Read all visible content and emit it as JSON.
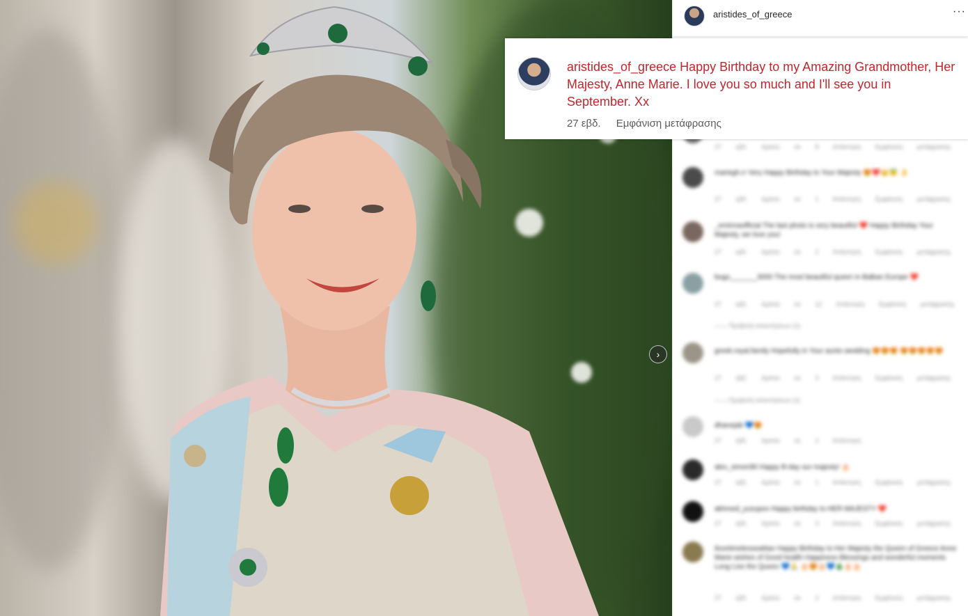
{
  "post": {
    "username": "aristides_of_greece",
    "caption_text": "Happy Birthday to my Amazing Grandmother, Her Majesty, Anne Marie. I love you so much and I'll see you in September. Xx",
    "time_ago": "27 εβδ.",
    "translation_link": "Εμφάνιση μετάφρασης"
  },
  "comments": [
    {
      "avatar_color": "#6b6b6b",
      "text": "",
      "meta": "27 εβδ. Αρέσει σε 8 Απάντηση Εμφάνιση μετάφρασης"
    },
    {
      "avatar_color": "#4b4b4b",
      "text": "mariegh.rr Very Happy Birthday to Your Majesty 😍❤️👑😇 👌",
      "meta": "27 εβδ. Αρέσει σε 1 Απάντηση Εμφάνιση μετάφρασης"
    },
    {
      "avatar_color": "#7a6760",
      "text": "_eminnaofficial The last photo is very beautiful ❤️ Happy Birthday Your Majesty, we love you!",
      "meta": "27 εβδ. Αρέσει σε 2 Απάντηση Εμφάνιση μετάφρασης"
    },
    {
      "avatar_color": "#8aa0a4",
      "text": "bogo_______3000 The most beautiful queen in Balkan Europe ❤️",
      "meta": "27 εβδ. Αρέσει σε 12 Απάντηση Εμφάνιση μετάφρασης",
      "replies": "—— Προβολή απαντήσεων (1)"
    },
    {
      "avatar_color": "#9c9488",
      "text": "greek.royal.family Hopefully in Your aunts wedding 😍😍😍 😍😍😍😍😍",
      "meta": "27 εβδ. Αρέσει σε 3 Απάντηση Εμφάνιση μετάφρασης",
      "replies": "—— Προβολή απαντήσεων (1)"
    },
    {
      "avatar_color": "#c9c9c9",
      "text": "dhanejab 💙😍",
      "meta": "27 εβδ. Αρέσει σε 2 Απάντηση"
    },
    {
      "avatar_color": "#2a2a2a",
      "text": "alex_simon90 Happy B-day our majesty! 🎂",
      "meta": "27 εβδ. Αρέσει σε 1 Απάντηση Εμφάνιση μετάφρασης"
    },
    {
      "avatar_color": "#111111",
      "text": "akhmed_yusupov Happy birthday to HER MAJESTY ❤️",
      "meta": "27 εβδ. Αρέσει σε 3 Απάντηση Εμφάνιση μετάφρασης"
    },
    {
      "avatar_color": "#8a7a50",
      "text": "ilovetimelesseattian Happy Birthday to Her Majesty the Queen of Greece Anne Marie wishes of Good health Happiness Blessings and wonderful moments Long Live the Queen 💙🙏 🎂😍🎂💙🎄🎂🎂",
      "meta": "27 εβδ. Αρέσει σε 2 Απάντηση Εμφάνιση μετάφρασης"
    }
  ],
  "colors": {
    "caption_red": "#c0272d",
    "meta_gray": "#5c5c5c"
  },
  "icons": {
    "carousel_next": "chevron-right-icon",
    "more": "more-horizontal-icon"
  },
  "glyphs": {
    "chevron": "›",
    "more": "···"
  }
}
